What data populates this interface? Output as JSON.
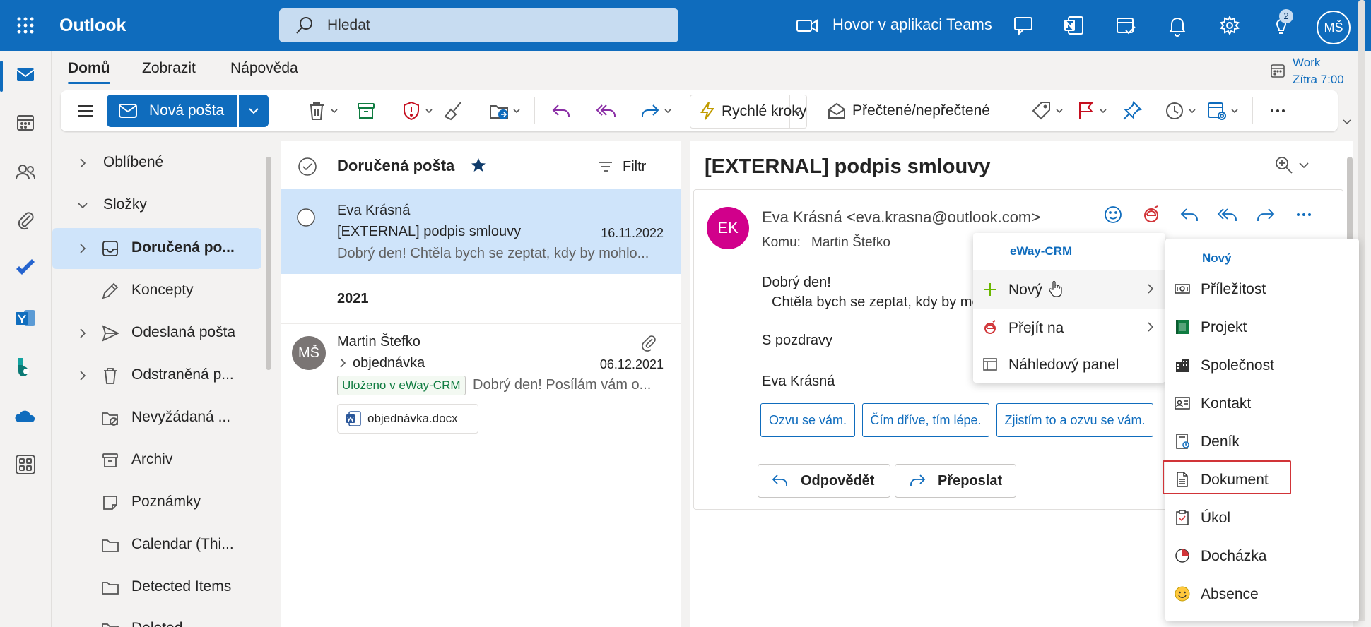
{
  "app": {
    "name": "Outlook"
  },
  "search": {
    "placeholder": "Hledat"
  },
  "topbar": {
    "teams_label": "Hovor v aplikaci Teams",
    "notification_count": "2",
    "user_initials": "MŠ"
  },
  "ribbon": {
    "tabs": [
      "Domů",
      "Zobrazit",
      "Nápověda"
    ],
    "new_mail": "Nová pošta",
    "quick_steps": "Rychlé kroky",
    "read_unread": "Přečtené/nepřečtené"
  },
  "calendar_peek": {
    "title": "Work",
    "subtitle": "Zítra 7:00"
  },
  "folders": {
    "favorites": "Oblíbené",
    "folders_label": "Složky",
    "items": [
      "Doručená po...",
      "Koncepty",
      "Odeslaná pošta",
      "Odstraněná p...",
      "Nevyžádaná ...",
      "Archiv",
      "Poznámky",
      "Calendar (Thi...",
      "Detected Items",
      "Deleted..."
    ]
  },
  "message_list": {
    "title": "Doručená pošta",
    "filter": "Filtr",
    "year_group": "2021",
    "messages": [
      {
        "sender": "Eva Krásná",
        "subject": "[EXTERNAL] podpis smlouvy",
        "date": "16.11.2022",
        "preview": "Dobrý den! Chtěla bych se zeptat, kdy by mohlo..."
      },
      {
        "initials": "MŠ",
        "sender": "Martin Štefko",
        "subject": "objednávka",
        "date": "06.12.2021",
        "tag": "Uloženo v eWay-CRM",
        "preview": "Dobrý den! Posílám vám o...",
        "attachment": "objednávka.docx"
      }
    ]
  },
  "reading": {
    "title": "[EXTERNAL] podpis smlouvy",
    "sender_initials": "EK",
    "from": "Eva Krásná <eva.krasna@outlook.com>",
    "to_label": "Komu:",
    "to": "Martin Štefko",
    "greeting": "Dobrý den!",
    "body_line": "Chtěla bych se zeptat, kdy by mo",
    "regards": "S pozdravy",
    "signature": "Eva Krásná",
    "quick_replies": [
      "Ozvu se vám.",
      "Čím dříve, tím lépe.",
      "Zjistím to a ozvu se vám."
    ],
    "reply": "Odpovědět",
    "forward": "Přeposlat"
  },
  "menu_crm": {
    "header": "eWay-CRM",
    "items": [
      "Nový",
      "Přejít na",
      "Náhledový panel"
    ]
  },
  "menu_new": {
    "header": "Nový",
    "items": [
      "Příležitost",
      "Projekt",
      "Společnost",
      "Kontakt",
      "Deník",
      "Dokument",
      "Úkol",
      "Docházka",
      "Absence"
    ]
  }
}
